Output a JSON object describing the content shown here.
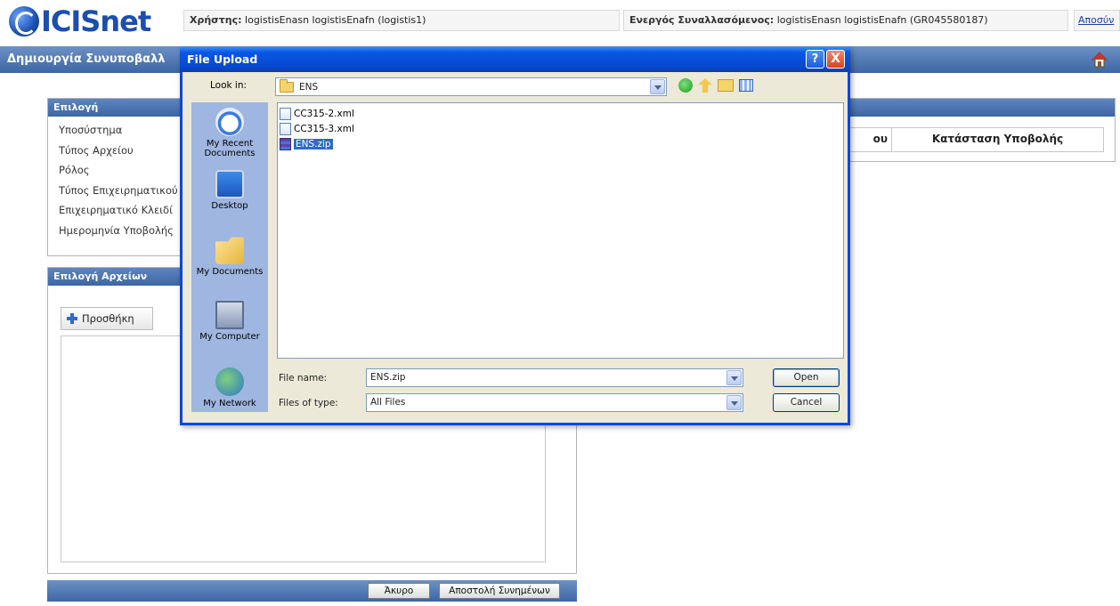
{
  "header": {
    "logo_text": "ICISnet",
    "user_label": "Χρήστης:",
    "user_value": "logistisEnasn logistisEnafn (logistis1)",
    "client_label": "Ενεργός Συναλλασόμενος:",
    "client_value": "logistisEnasn logistisEnafn (GR045580187)",
    "logout_link": "Αποσύν"
  },
  "titlebar": {
    "title": "Δημιουργία Συνυποβαλλ"
  },
  "selection_panel": {
    "title": "Επιλογή",
    "fields": [
      "Υποσύστημα",
      "Τύπος Αρχείου",
      "Ρόλος",
      "Τύπος Επιχειρηματικού",
      "Επιχειρηματικό Κλειδί",
      "Ημερομηνία Υποβολής"
    ]
  },
  "files_panel": {
    "title": "Επιλογή Αρχείων",
    "add_button": "Προσθήκη"
  },
  "right_panel": {
    "col1_header": "ου",
    "col2_header": "Κατάσταση Υποβολής"
  },
  "bottom_bar": {
    "cancel_button": "Άκυρο",
    "send_button": "Αποστολή Συνημένων"
  },
  "dialog": {
    "title": "File Upload",
    "help_button": "?",
    "close_button": "X",
    "look_in_label": "Look in:",
    "look_in_value": "ENS",
    "places": [
      "My Recent\nDocuments",
      "Desktop",
      "My Documents",
      "My Computer",
      "My Network"
    ],
    "files": [
      {
        "name": "CC315-2.xml",
        "type": "xml",
        "selected": false
      },
      {
        "name": "CC315-3.xml",
        "type": "xml",
        "selected": false
      },
      {
        "name": "ENS.zip",
        "type": "zip",
        "selected": true
      }
    ],
    "file_name_label": "File name:",
    "file_name_value": "ENS.zip",
    "file_type_label": "Files of type:",
    "file_type_value": "All Files",
    "open_button": "Open",
    "cancel_button": "Cancel"
  }
}
